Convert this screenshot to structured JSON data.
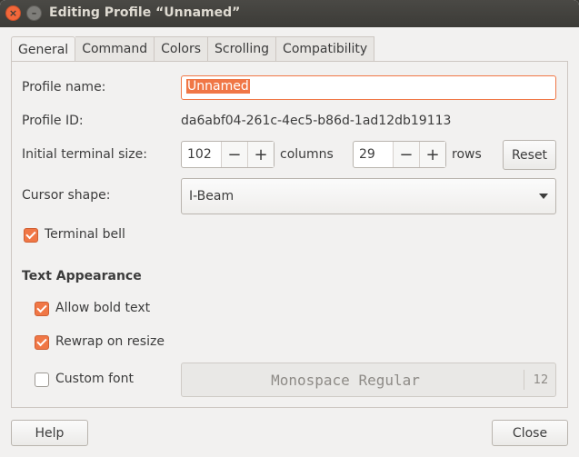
{
  "window": {
    "title": "Editing Profile “Unnamed”",
    "close_glyph": "×",
    "minimize_glyph": "–"
  },
  "tabs": [
    {
      "label": "General",
      "active": true
    },
    {
      "label": "Command",
      "active": false
    },
    {
      "label": "Colors",
      "active": false
    },
    {
      "label": "Scrolling",
      "active": false
    },
    {
      "label": "Compatibility",
      "active": false
    }
  ],
  "general": {
    "profile_name_label": "Profile name:",
    "profile_name_value": "Unnamed",
    "profile_id_label": "Profile ID:",
    "profile_id_value": "da6abf04-261c-4ec5-b86d-1ad12db19113",
    "terminal_size_label": "Initial terminal size:",
    "columns_value": "102",
    "columns_label": "columns",
    "rows_value": "29",
    "rows_label": "rows",
    "minus_glyph": "−",
    "plus_glyph": "+",
    "reset_label": "Reset",
    "cursor_shape_label": "Cursor shape:",
    "cursor_shape_value": "I-Beam",
    "terminal_bell_label": "Terminal bell",
    "terminal_bell_checked": true
  },
  "text_appearance": {
    "heading": "Text Appearance",
    "allow_bold_label": "Allow bold text",
    "allow_bold_checked": true,
    "rewrap_label": "Rewrap on resize",
    "rewrap_checked": true,
    "custom_font_label": "Custom font",
    "custom_font_checked": false,
    "font_name": "Monospace Regular",
    "font_size": "12"
  },
  "footer": {
    "help_label": "Help",
    "close_label": "Close"
  },
  "colors": {
    "accent": "#f07746",
    "titlebar": "#3c3b37",
    "window_bg": "#f2f1f0"
  }
}
